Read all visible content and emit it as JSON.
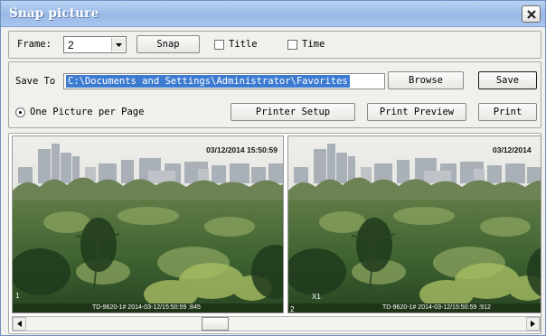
{
  "window": {
    "title": "Snap picture"
  },
  "row1": {
    "frame_label": "Frame:",
    "frame_value": "2",
    "snap_label": "Snap",
    "title_label": "Title",
    "title_checked": false,
    "time_label": "Time",
    "time_checked": false
  },
  "row2": {
    "save_to_label": "Save To",
    "path_value": "C:\\Documents and Settings\\Administrator\\Favorites",
    "browse_label": "Browse",
    "save_label": "Save",
    "one_picture_label": "One Picture per Page",
    "printer_setup_label": "Printer Setup",
    "print_preview_label": "Print Preview",
    "print_label": "Print"
  },
  "pictures": [
    {
      "timestamp": "03/12/2014 15:50:59",
      "index": "1",
      "osd": "TD-9620-1#  2014-03-12/15:50:59 :845"
    },
    {
      "timestamp": "03/12/2014",
      "index": "2",
      "zoom": "X1",
      "osd": "TD-9620-1#  2014-03-12/15:50:59 :912"
    }
  ],
  "scrollbar": {
    "position": 0.37
  },
  "icons": {
    "close": "close-icon",
    "dropdown": "chevron-down-icon",
    "scroll_left": "arrow-left-icon",
    "scroll_right": "arrow-right-icon"
  },
  "colors": {
    "title_bar": "#a9c6ee",
    "selection": "#3d7bd1",
    "window_bg": "#f0f0ec"
  }
}
